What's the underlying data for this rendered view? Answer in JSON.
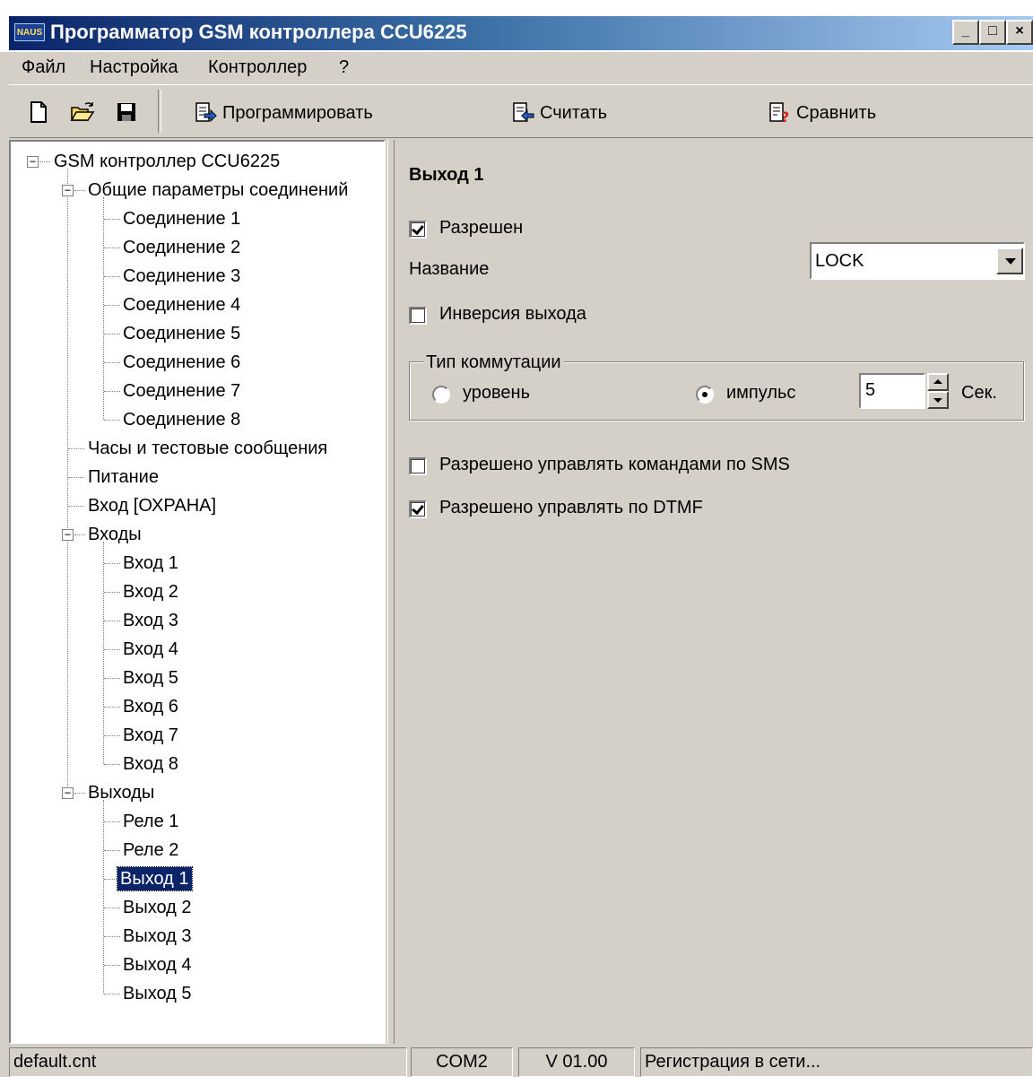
{
  "window": {
    "title": "Программатор GSM контроллера CCU6225",
    "app_icon_text": "NAUS",
    "minimize": "_",
    "maximize": "□",
    "close": "×"
  },
  "menu": [
    "Файл",
    "Настройка",
    "Контроллер",
    "?"
  ],
  "toolbar": {
    "program_label": "Программировать",
    "read_label": "Считать",
    "compare_label": "Сравнить",
    "icons": [
      "new-file-icon",
      "open-folder-icon",
      "save-disk-icon"
    ]
  },
  "tree": {
    "root": "GSM контроллер CCU6225",
    "general": "Общие параметры соединений",
    "connections": [
      "Соединение 1",
      "Соединение 2",
      "Соединение 3",
      "Соединение 4",
      "Соединение 5",
      "Соединение 6",
      "Соединение 7",
      "Соединение 8"
    ],
    "clock": "Часы и тестовые сообщения",
    "power": "Питание",
    "guard_input": "Вход [ОХРАНА]",
    "inputs_title": "Входы",
    "inputs": [
      "Вход 1",
      "Вход 2",
      "Вход 3",
      "Вход 4",
      "Вход 5",
      "Вход 6",
      "Вход 7",
      "Вход 8"
    ],
    "outputs_title": "Выходы",
    "outputs": [
      "Реле 1",
      "Реле 2",
      "Выход 1",
      "Выход 2",
      "Выход 3",
      "Выход 4",
      "Выход 5"
    ],
    "selected": "Выход 1"
  },
  "panel": {
    "heading": "Выход 1",
    "enabled_label": "Разрешен",
    "enabled_checked": true,
    "name_label": "Название",
    "name_value": "LOCK",
    "inversion_label": "Инверсия выхода",
    "inversion_checked": false,
    "switch_type_title": "Тип коммутации",
    "level_label": "уровень",
    "pulse_label": "импульс",
    "pulse_selected": true,
    "pulse_value": "5",
    "seconds_label": "Сек.",
    "sms_label": "Разрешено управлять командами по SMS",
    "sms_checked": false,
    "dtmf_label": "Разрешено управлять по DTMF",
    "dtmf_checked": true
  },
  "status": {
    "file": "default.cnt",
    "port": "COM2",
    "version": "V 01.00",
    "state": "Регистрация в сети..."
  },
  "colors": {
    "title_start": "#0a246a",
    "title_end": "#a6caf0",
    "face": "#d4d0c8",
    "selection": "#0a246a"
  }
}
